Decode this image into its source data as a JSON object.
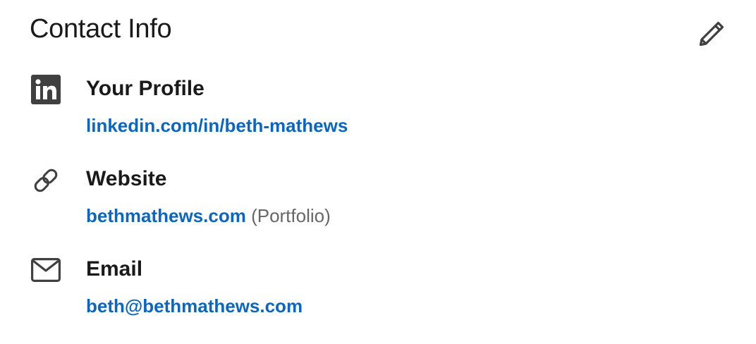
{
  "header": {
    "title": "Contact Info",
    "edit_icon": "pencil-icon"
  },
  "sections": [
    {
      "icon": "linkedin-icon",
      "label": "Your Profile",
      "link": "linkedin.com/in/beth-mathews",
      "note": ""
    },
    {
      "icon": "link-icon",
      "label": "Website",
      "link": "bethmathews.com",
      "note": "(Portfolio)"
    },
    {
      "icon": "envelope-icon",
      "label": "Email",
      "link": "beth@bethmathews.com",
      "note": ""
    }
  ],
  "colors": {
    "link": "#0a66c2",
    "text": "#191919",
    "muted": "#666666",
    "icon": "#404040"
  }
}
